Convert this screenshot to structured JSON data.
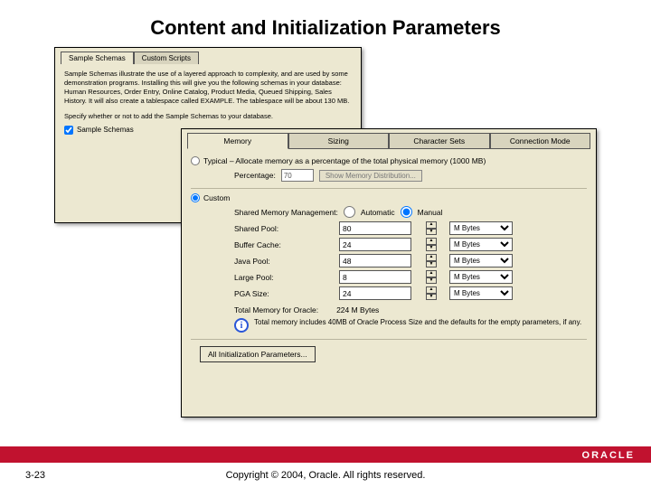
{
  "title": "Content and Initialization Parameters",
  "back": {
    "tab1": "Sample Schemas",
    "tab2": "Custom Scripts",
    "paragraph": "Sample Schemas illustrate the use of a layered approach to complexity, and are used by some demonstration programs. Installing this will give you the following schemas in your database: Human Resources, Order Entry, Online Catalog, Product Media, Queued Shipping, Sales History. It will also create a tablespace called EXAMPLE. The tablespace will be about 130 MB.",
    "spec": "Specify whether or not to add the Sample Schemas to your database.",
    "checkbox": "Sample Schemas"
  },
  "front": {
    "tabs": [
      "Memory",
      "Sizing",
      "Character Sets",
      "Connection Mode"
    ],
    "typical": "Typical – Allocate memory as a percentage of the total physical memory (1000 MB)",
    "percentLabel": "Percentage:",
    "percentVal": "70",
    "showBtn": "Show Memory Distribution...",
    "custom": "Custom",
    "smm": "Shared Memory Management:",
    "auto": "Automatic",
    "manual": "Manual",
    "rows": [
      {
        "label": "Shared Pool:",
        "value": "80",
        "unit": "M Bytes"
      },
      {
        "label": "Buffer Cache:",
        "value": "24",
        "unit": "M Bytes"
      },
      {
        "label": "Java Pool:",
        "value": "48",
        "unit": "M Bytes"
      },
      {
        "label": "Large Pool:",
        "value": "8",
        "unit": "M Bytes"
      },
      {
        "label": "PGA Size:",
        "value": "24",
        "unit": "M Bytes"
      }
    ],
    "totalLabel": "Total Memory for Oracle:",
    "totalVal": "224 M Bytes",
    "info": "Total memory includes 40MB of Oracle Process Size and the defaults for the empty parameters, if any.",
    "allBtn": "All Initialization Parameters..."
  },
  "footer": {
    "page": "3-23",
    "copy": "Copyright © 2004, Oracle. All rights reserved.",
    "brand": "ORACLE"
  }
}
